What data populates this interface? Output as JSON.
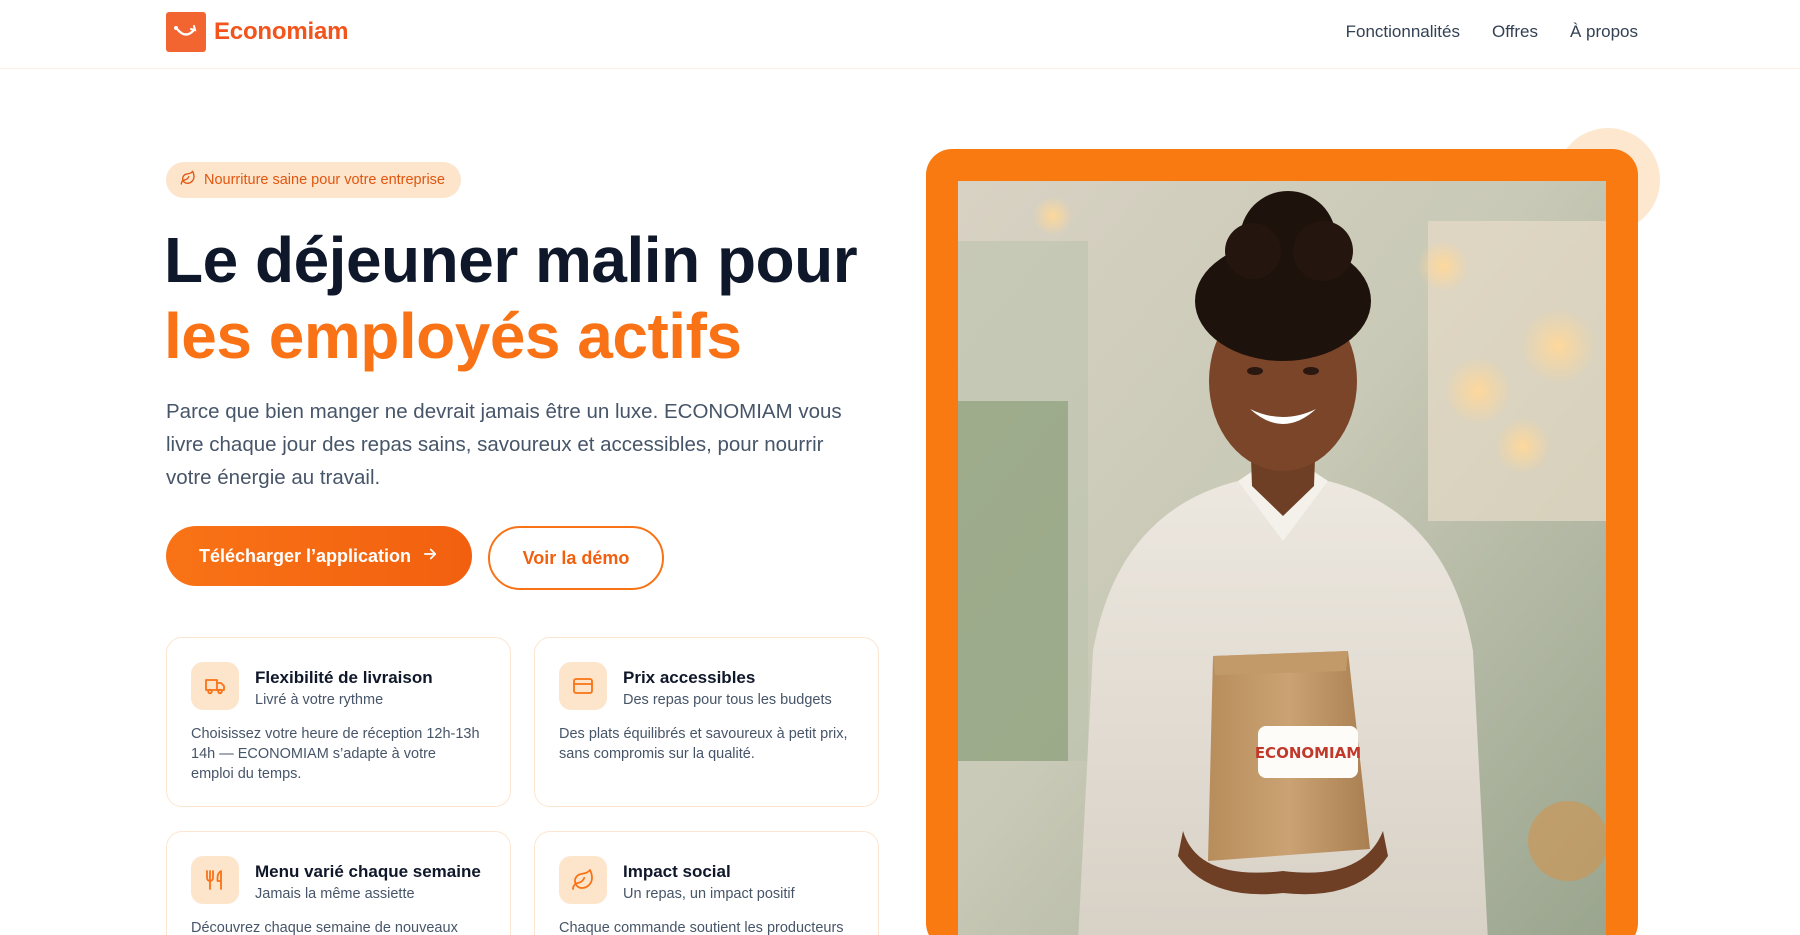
{
  "brand": {
    "name": "Economiam"
  },
  "nav": {
    "items": [
      "Fonctionnalités",
      "Offres",
      "À propos"
    ]
  },
  "hero": {
    "badge": "Nourriture saine pour votre entreprise",
    "title_line1": "Le déjeuner malin pour",
    "title_line2": "les employés actifs",
    "lead": "Parce que bien manger ne devrait jamais être un luxe. ECONOMIAM vous livre chaque jour des repas sains, savoureux et accessibles, pour nourrir votre énergie au travail.",
    "cta_primary": "Télécharger l’application",
    "cta_secondary": "Voir la démo"
  },
  "features": [
    {
      "icon": "truck-icon",
      "title": "Flexibilité de livraison",
      "subtitle": "Livré à votre rythme",
      "desc": "Choisissez votre heure de réception 12h-13h 14h — ECONOMIAM s’adapte à votre emploi du temps."
    },
    {
      "icon": "credit-card-icon",
      "title": "Prix accessibles",
      "subtitle": "Des repas pour tous les budgets",
      "desc": "Des plats équilibrés et savoureux à petit prix, sans compromis sur la qualité."
    },
    {
      "icon": "utensils-icon",
      "title": "Menu varié chaque semaine",
      "subtitle": "Jamais la même assiette",
      "desc": "Découvrez chaque semaine de nouveaux"
    },
    {
      "icon": "leaf-icon",
      "title": "Impact social",
      "subtitle": "Un repas, un impact positif",
      "desc": "Chaque commande soutient les producteurs"
    }
  ],
  "photo": {
    "bag_label": "ECONOMIAM"
  },
  "colors": {
    "accent": "#f97316",
    "brand": "#f2541b",
    "badge_bg": "#fde5cc",
    "text_dark": "#0f172a",
    "text_muted": "#475569"
  }
}
